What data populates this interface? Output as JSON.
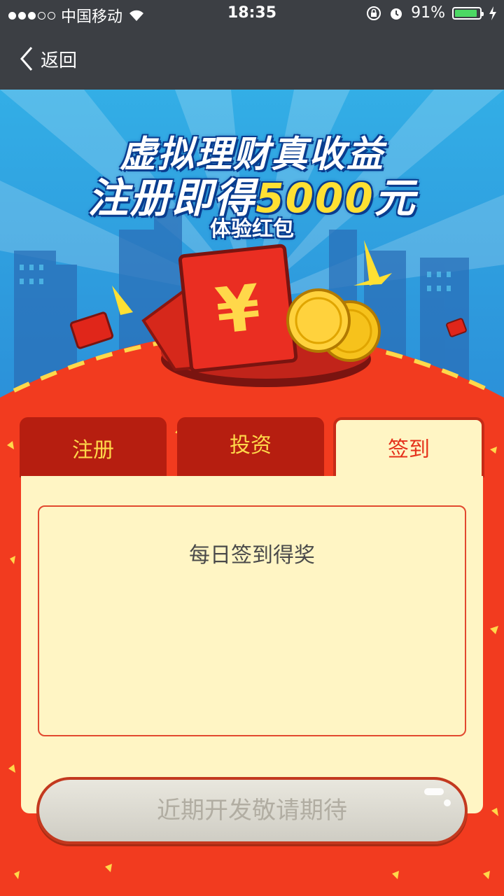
{
  "status_bar": {
    "carrier": "中国移动",
    "time": "18:35",
    "battery_percent": "91%",
    "battery_level": 0.91,
    "signal_icon": "signal-dots-icon",
    "wifi_icon": "wifi-icon",
    "lock_icon": "orientation-lock-icon",
    "alarm_icon": "alarm-icon",
    "charging_icon": "charging-bolt-icon"
  },
  "nav": {
    "back_label": "返回",
    "back_icon": "chevron-left-icon"
  },
  "hero": {
    "line1": "虚拟理财真收益",
    "line2_prefix": "注册即得",
    "line2_amount": "5000",
    "line2_suffix": "元",
    "line3": "体验红包"
  },
  "tabs": [
    {
      "label": "注册",
      "active": false
    },
    {
      "label": "投资",
      "active": false
    },
    {
      "label": "签到",
      "active": true
    }
  ],
  "content": {
    "title": "每日签到得奖"
  },
  "button": {
    "label": "近期开发敬请期待"
  },
  "colors": {
    "header_bg": "#3c3f44",
    "sky": "#33aee6",
    "red_bg": "#f23b1f",
    "tab_dark": "#b61e10",
    "tab_text": "#ffd84a",
    "panel_bg": "#fff5c4",
    "gold": "#ffd84a"
  }
}
